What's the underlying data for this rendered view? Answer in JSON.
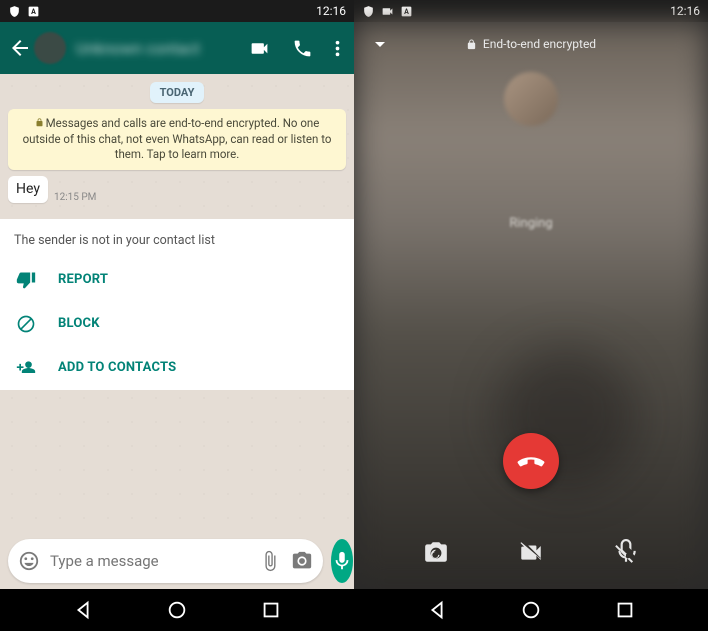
{
  "left": {
    "status": {
      "time": "12:16"
    },
    "header": {
      "name": "Unknown contact"
    },
    "chat": {
      "date_label": "TODAY",
      "encryption_notice": "Messages and calls are end-to-end encrypted. No one outside of this chat, not even WhatsApp, can read or listen to them. Tap to learn more.",
      "messages": [
        {
          "text": "Hey",
          "time": "12:15 PM"
        }
      ],
      "sender_warning": "The sender is not in your contact list",
      "actions": {
        "report": "REPORT",
        "block": "BLOCK",
        "add": "ADD TO CONTACTS"
      }
    },
    "input": {
      "placeholder": "Type a message"
    }
  },
  "right": {
    "status": {
      "time": "12:16"
    },
    "encrypted_label": "End-to-end encrypted",
    "call_state": "Ringing"
  }
}
